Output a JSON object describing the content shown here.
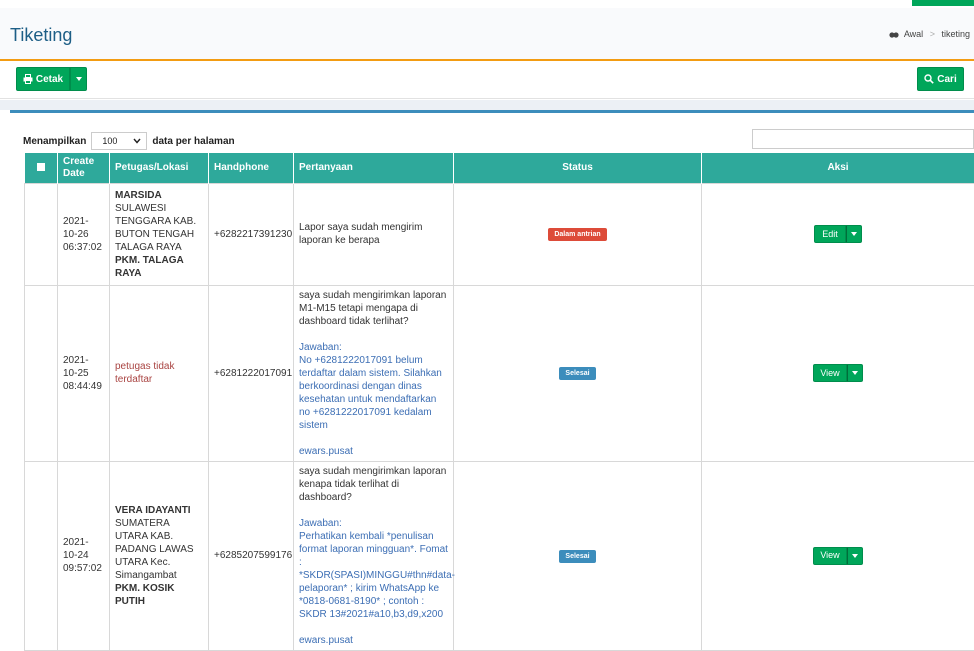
{
  "page": {
    "title": "Tiketing",
    "breadcrumb": {
      "home": "Awal",
      "current": "tiketing"
    }
  },
  "toolbar": {
    "print_label": "Cetak",
    "search_button_label": "Cari"
  },
  "table_controls": {
    "length_prefix": "Menampilkan",
    "length_value": "100",
    "length_suffix": "data per halaman",
    "search_value": ""
  },
  "table": {
    "headers": {
      "create_date": "Create Date",
      "officer": "Petugas/Lokasi",
      "phone": "Handphone",
      "question": "Pertanyaan",
      "status": "Status",
      "action": "Aksi"
    },
    "rows": [
      {
        "date": "2021-",
        "date2": "10-26",
        "time": "06:37:02",
        "officer_name": "MARSIDA",
        "location": "SULAWESI TENGGARA KAB. BUTON TENGAH TALAGA RAYA",
        "facility": "PKM. TALAGA RAYA",
        "phone": "+6282217391230",
        "question": "Lapor saya sudah mengirim laporan ke berapa",
        "answer_label": "",
        "answer": "",
        "answered_by": "",
        "status": "Dalam antrian",
        "action": "Edit"
      },
      {
        "date": "2021-",
        "date2": "10-25",
        "time": "08:44:49",
        "officer_name": "",
        "location": "petugas tidak terdaftar",
        "facility": "",
        "phone": "+6281222017091",
        "question": "saya sudah mengirimkan laporan M1-M15 tetapi mengapa di dashboard tidak terlihat?",
        "answer_label": "Jawaban:",
        "answer": "No +6281222017091 belum terdaftar dalam sistem. Silahkan berkoordinasi dengan dinas kesehatan untuk mendaftarkan no +6281222017091 kedalam sistem",
        "answered_by": "ewars.pusat",
        "status": "Selesai",
        "action": "View"
      },
      {
        "date": "2021-",
        "date2": "10-24",
        "time": "09:57:02",
        "officer_name": "VERA IDAYANTI",
        "location": "SUMATERA UTARA KAB. PADANG LAWAS UTARA Kec. Simangambat",
        "facility": "PKM. KOSIK PUTIH",
        "phone": "+6285207599176",
        "question": "saya sudah mengirimkan laporan kenapa tidak terlihat di dashboard?",
        "answer_label": "Jawaban:",
        "answer": "Perhatikan kembali *penulisan format laporan mingguan*. Fomat : *SKDR(SPASI)MINGGU#thn#data-pelaporan* ; kirim WhatsApp ke *0818-0681-8190* ; contoh : SKDR 13#2021#a10,b3,d9,x200",
        "answered_by": "ewars.pusat",
        "status": "Selesai",
        "action": "View"
      }
    ]
  },
  "colors": {
    "accent_green": "#00a65a",
    "table_header": "#2ea99b",
    "box_border_top": "#3c8dbc",
    "header_rule": "#f39c12",
    "status_queue": "#dd4b39",
    "status_done": "#3c8dbc"
  },
  "icons": {
    "print": "print-icon",
    "search": "search-icon",
    "home": "dashboard-icon",
    "dropdown": "caret-down-icon"
  }
}
